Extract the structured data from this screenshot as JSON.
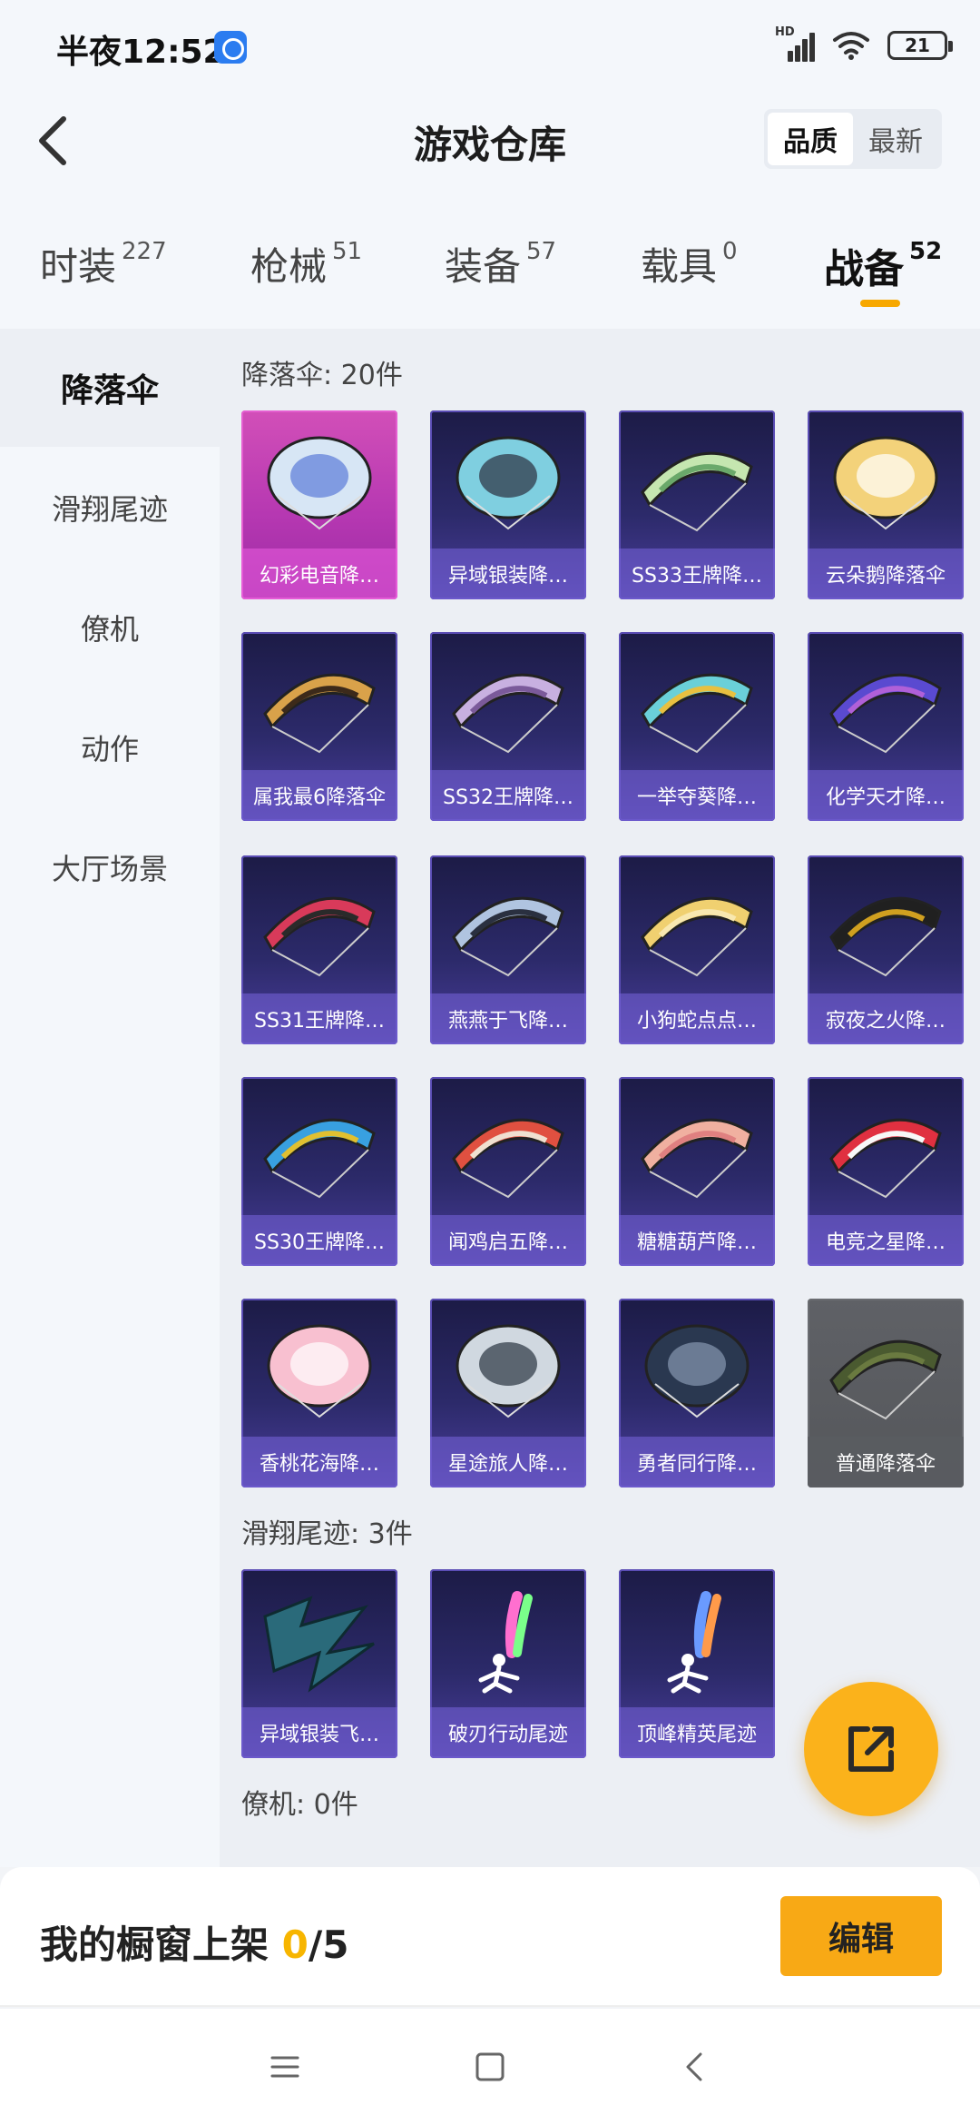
{
  "status_bar": {
    "time": "半夜12:52",
    "signal_label": "HD",
    "battery": "21"
  },
  "header": {
    "title": "游戏仓库",
    "sort_options": [
      "品质",
      "最新"
    ],
    "active_sort": "品质"
  },
  "tabs": [
    {
      "label": "时装",
      "count": "227"
    },
    {
      "label": "枪械",
      "count": "51"
    },
    {
      "label": "装备",
      "count": "57"
    },
    {
      "label": "载具",
      "count": "0"
    },
    {
      "label": "战备",
      "count": "52",
      "active": true
    }
  ],
  "sidebar": {
    "items": [
      "降落伞",
      "滑翔尾迹",
      "僚机",
      "动作",
      "大厅场景"
    ],
    "active": "降落伞"
  },
  "sections": {
    "parachute": {
      "title": "降落伞: 20件",
      "items": [
        "幻彩电音降…",
        "异域银装降…",
        "SS33王牌降…",
        "云朵鹅降落伞",
        "属我最6降落伞",
        "SS32王牌降…",
        "一举夺葵降…",
        "化学天才降…",
        "SS31王牌降…",
        "燕燕于飞降…",
        "小狗蛇点点…",
        "寂夜之火降…",
        "SS30王牌降…",
        "闻鸡启五降…",
        "糖糖葫芦降…",
        "电竞之星降…",
        "香桃花海降…",
        "星途旅人降…",
        "勇者同行降…",
        "普通降落伞"
      ]
    },
    "glide_trail": {
      "title": "滑翔尾迹: 3件",
      "items": [
        "异域银装飞…",
        "破刃行动尾迹",
        "顶峰精英尾迹"
      ]
    },
    "wingman": {
      "title": "僚机: 0件"
    }
  },
  "bottom_bar": {
    "showcase_label": "我的橱窗上架 ",
    "showcase_current": "0",
    "showcase_total": "/5",
    "edit_label": "编辑"
  },
  "colors": {
    "accent": "#f8a915",
    "card_bg": "#2c2a6a",
    "card_pink": "#b638b2",
    "card_gray": "#5a5c60"
  }
}
